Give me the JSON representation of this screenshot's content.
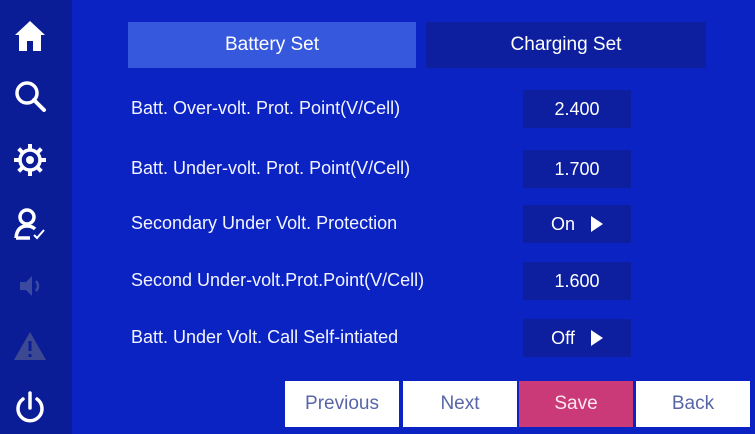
{
  "sidebar": {
    "icons": [
      "home-icon",
      "search-icon",
      "gear-icon",
      "user-check-icon",
      "speaker-icon",
      "warning-icon",
      "power-icon"
    ]
  },
  "tabs": [
    {
      "label": "Battery Set",
      "active": true
    },
    {
      "label": "Charging Set",
      "active": false
    }
  ],
  "settings": [
    {
      "label": "Batt. Over-volt. Prot. Point(V/Cell)",
      "value": "2.400",
      "has_arrow": false
    },
    {
      "label": "Batt. Under-volt. Prot. Point(V/Cell)",
      "value": "1.700",
      "has_arrow": false
    },
    {
      "label": "Secondary Under Volt. Protection",
      "value": "On",
      "has_arrow": true
    },
    {
      "label": "Second Under-volt.Prot.Point(V/Cell)",
      "value": "1.600",
      "has_arrow": false
    },
    {
      "label": "Batt. Under Volt. Call Self-intiated",
      "value": "Off",
      "has_arrow": true
    }
  ],
  "buttons": {
    "previous": "Previous",
    "next": "Next",
    "save": "Save",
    "back": "Back"
  },
  "colors": {
    "background": "#0c23c4",
    "sidebar": "#0a1d97",
    "active_tab": "#3558dd",
    "field": "#0d1f9e",
    "save": "#cb3a78"
  }
}
